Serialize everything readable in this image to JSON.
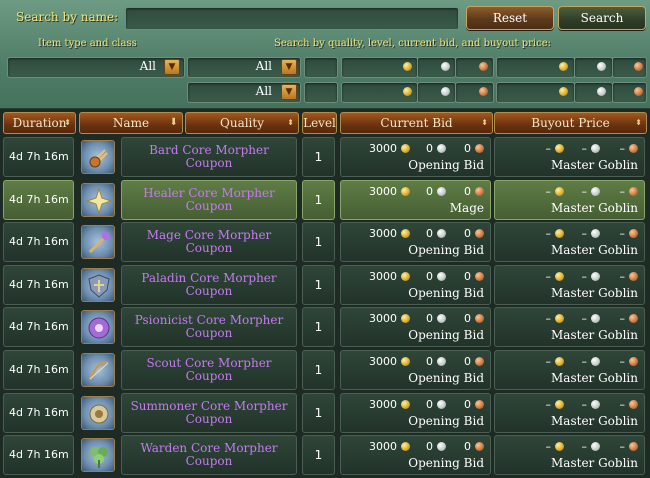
{
  "filters": {
    "search_label": "Search by name:",
    "search_value": "",
    "reset_label": "Reset",
    "search_button_label": "Search",
    "item_type_label": "Item type and class",
    "quality_label": "Search by quality, level, current bid, and buyout price:",
    "type_value": "All",
    "class_value_1": "All",
    "class_value_2": "All"
  },
  "columns": {
    "duration": "Duration",
    "name": "Name",
    "quality": "Quality",
    "level": "Level",
    "current_bid": "Current Bid",
    "buyout_price": "Buyout Price"
  },
  "rows": [
    {
      "duration": "4d 7h 16m",
      "name": "Bard Core Morpher Coupon",
      "level": "1",
      "bid_gold": "3000",
      "bid_silver": "0",
      "bid_copper": "0",
      "bid_status": "Opening Bid",
      "buy_gold": "–",
      "buy_silver": "–",
      "buy_copper": "–",
      "seller": "Master Goblin",
      "icon": "bard-icon"
    },
    {
      "duration": "4d 7h 16m",
      "name": "Healer Core Morpher Coupon",
      "level": "1",
      "bid_gold": "3000",
      "bid_silver": "0",
      "bid_copper": "0",
      "bid_status": "Mage",
      "buy_gold": "–",
      "buy_silver": "–",
      "buy_copper": "–",
      "seller": "Master Goblin",
      "icon": "healer-icon",
      "selected": true
    },
    {
      "duration": "4d 7h 16m",
      "name": "Mage Core Morpher Coupon",
      "level": "1",
      "bid_gold": "3000",
      "bid_silver": "0",
      "bid_copper": "0",
      "bid_status": "Opening Bid",
      "buy_gold": "–",
      "buy_silver": "–",
      "buy_copper": "–",
      "seller": "Master Goblin",
      "icon": "mage-icon"
    },
    {
      "duration": "4d 7h 16m",
      "name": "Paladin Core Morpher Coupon",
      "level": "1",
      "bid_gold": "3000",
      "bid_silver": "0",
      "bid_copper": "0",
      "bid_status": "Opening Bid",
      "buy_gold": "–",
      "buy_silver": "–",
      "buy_copper": "–",
      "seller": "Master Goblin",
      "icon": "paladin-icon"
    },
    {
      "duration": "4d 7h 16m",
      "name": "Psionicist Core Morpher Coupon",
      "level": "1",
      "bid_gold": "3000",
      "bid_silver": "0",
      "bid_copper": "0",
      "bid_status": "Opening Bid",
      "buy_gold": "–",
      "buy_silver": "–",
      "buy_copper": "–",
      "seller": "Master Goblin",
      "icon": "psionicist-icon"
    },
    {
      "duration": "4d 7h 16m",
      "name": "Scout Core Morpher Coupon",
      "level": "1",
      "bid_gold": "3000",
      "bid_silver": "0",
      "bid_copper": "0",
      "bid_status": "Opening Bid",
      "buy_gold": "–",
      "buy_silver": "–",
      "buy_copper": "–",
      "seller": "Master Goblin",
      "icon": "scout-icon"
    },
    {
      "duration": "4d 7h 16m",
      "name": "Summoner Core Morpher Coupon",
      "level": "1",
      "bid_gold": "3000",
      "bid_silver": "0",
      "bid_copper": "0",
      "bid_status": "Opening Bid",
      "buy_gold": "–",
      "buy_silver": "–",
      "buy_copper": "–",
      "seller": "Master Goblin",
      "icon": "summoner-icon"
    },
    {
      "duration": "4d 7h 16m",
      "name": "Warden Core Morpher Coupon",
      "level": "1",
      "bid_gold": "3000",
      "bid_silver": "0",
      "bid_copper": "0",
      "bid_status": "Opening Bid",
      "buy_gold": "–",
      "buy_silver": "–",
      "buy_copper": "–",
      "seller": "Master Goblin",
      "icon": "warden-icon"
    }
  ]
}
